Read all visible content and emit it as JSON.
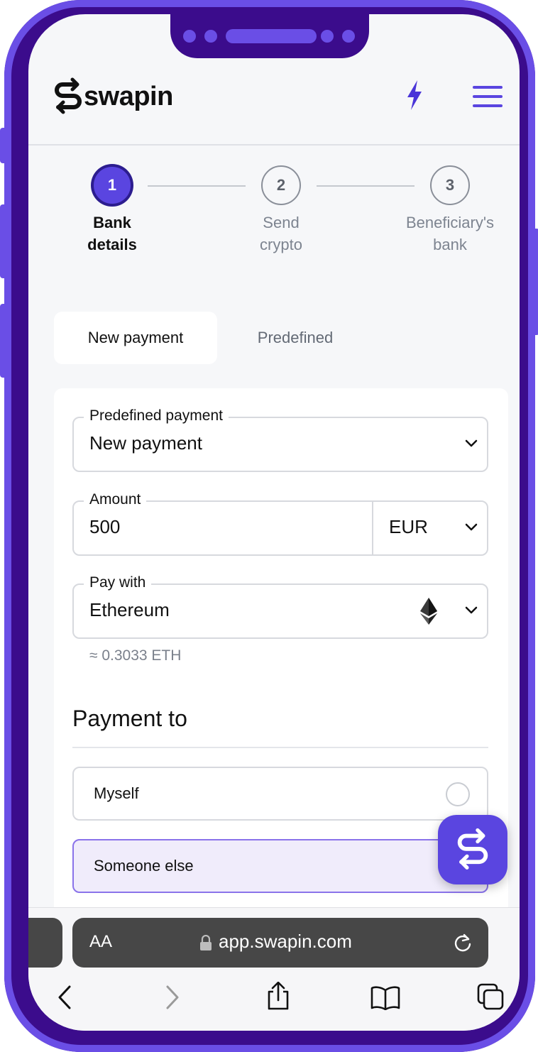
{
  "brand": {
    "name": "swapin",
    "accent": "#5a45e0",
    "frame": "#3b0c8c"
  },
  "header": {
    "bolt_icon": "lightning-icon",
    "menu_icon": "hamburger-icon"
  },
  "steps": [
    {
      "number": "1",
      "line1": "Bank",
      "line2": "details",
      "active": true
    },
    {
      "number": "2",
      "line1": "Send",
      "line2": "crypto",
      "active": false
    },
    {
      "number": "3",
      "line1": "Beneficiary's",
      "line2": "bank",
      "active": false
    }
  ],
  "tabs": {
    "new_payment": "New payment",
    "predefined": "Predefined"
  },
  "form": {
    "predefined_payment": {
      "label": "Predefined payment",
      "value": "New payment"
    },
    "amount": {
      "label": "Amount",
      "value": "500",
      "currency": "EUR"
    },
    "pay_with": {
      "label": "Pay with",
      "value": "Ethereum",
      "icon": "ethereum-icon"
    },
    "approx": "≈ 0.3033 ETH"
  },
  "payment_to": {
    "title": "Payment to",
    "options": [
      {
        "label": "Myself",
        "selected": false
      },
      {
        "label": "Someone else",
        "selected": true
      }
    ]
  },
  "browser": {
    "text_size": "AA",
    "url": "app.swapin.com"
  }
}
